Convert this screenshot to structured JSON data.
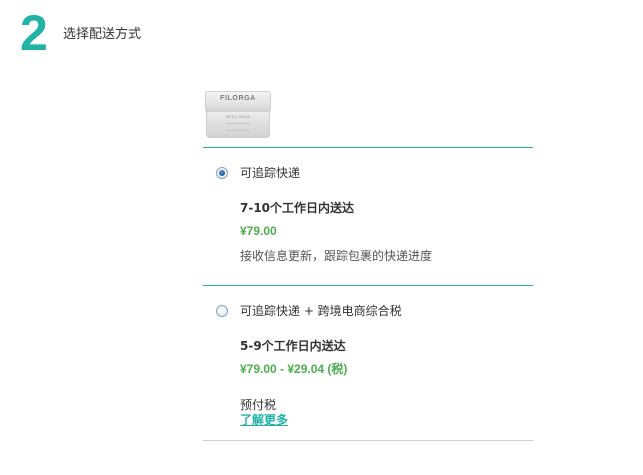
{
  "step": {
    "number": "2",
    "title": "选择配送方式"
  },
  "product": {
    "brand": "FILORGA",
    "sub_label": "MESO-MASK"
  },
  "shipping_options": [
    {
      "label": "可追踪快递",
      "selected": true,
      "delivery_time": "7-10个工作日内送达",
      "price": "¥79.00",
      "description": "接收信息更新，跟踪包裹的快递进度"
    },
    {
      "label": "可追踪快递 + 跨境电商综合税",
      "selected": false,
      "delivery_time": "5-9个工作日内送达",
      "price": "¥79.00 - ¥29.04 (税)",
      "prepaid_label": "预付税",
      "learn_more": "了解更多"
    }
  ],
  "colors": {
    "accent": "#21b3a6",
    "price": "#4cae4c",
    "divider": "#21b3a6",
    "radio_selected": "#1f5e99"
  }
}
